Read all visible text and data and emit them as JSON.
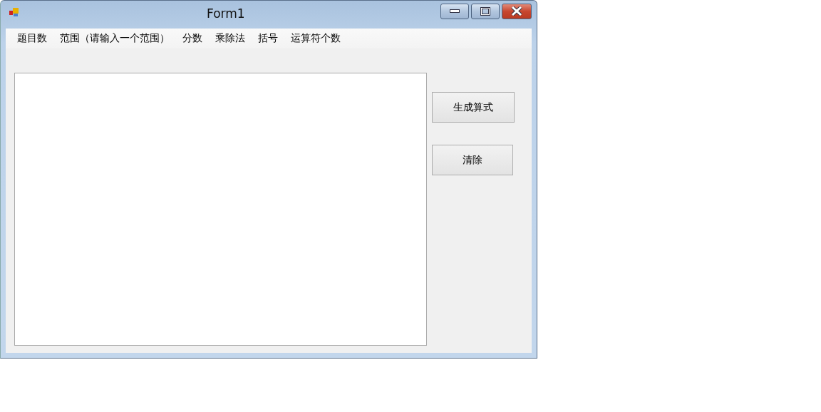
{
  "window": {
    "title": "Form1"
  },
  "menu": [
    "题目数",
    "范围（请输入一个范围）",
    "分数",
    "乘除法",
    "括号",
    "运算符个数"
  ],
  "buttons": [
    {
      "label": "生成算式",
      "kind": "wide"
    },
    {
      "label": "清除",
      "kind": "narrow"
    }
  ]
}
